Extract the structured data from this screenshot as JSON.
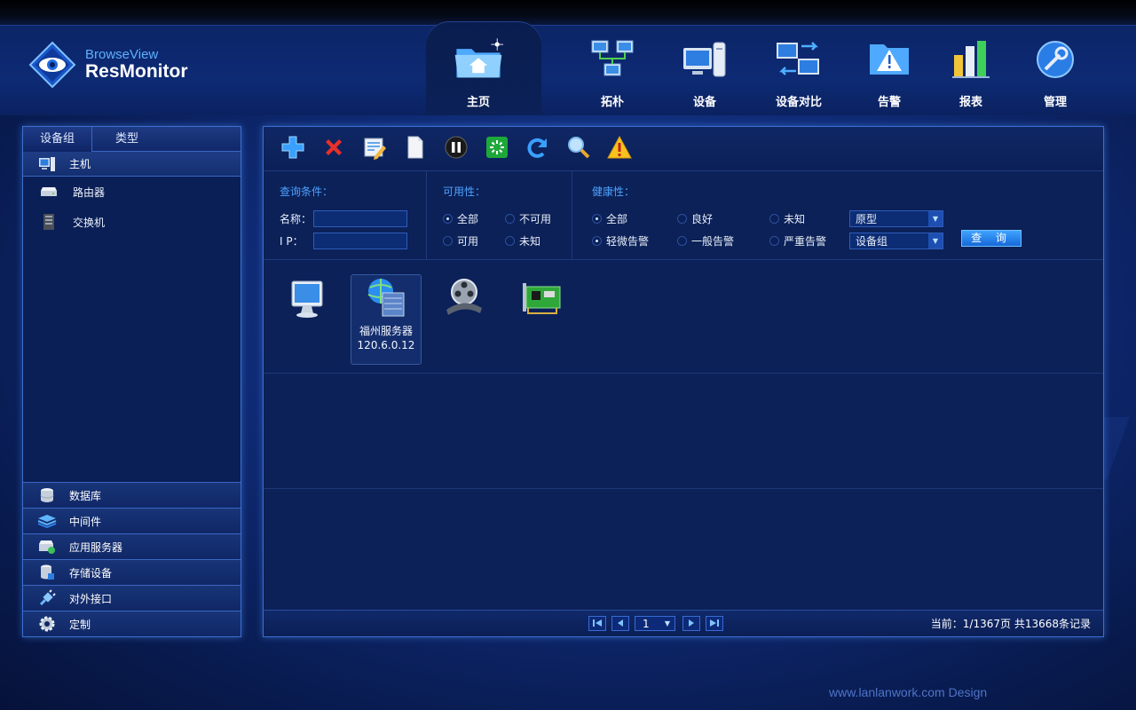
{
  "app": {
    "logo_sub": "BrowseView",
    "logo_main": "ResMonitor"
  },
  "nav": [
    {
      "label": "主页",
      "icon": "home-folder-icon",
      "active": true
    },
    {
      "label": "拓朴",
      "icon": "topology-icon"
    },
    {
      "label": "设备",
      "icon": "device-icon"
    },
    {
      "label": "设备对比",
      "icon": "device-compare-icon"
    },
    {
      "label": "告警",
      "icon": "alarm-icon"
    },
    {
      "label": "报表",
      "icon": "report-icon"
    },
    {
      "label": "管理",
      "icon": "manage-icon"
    }
  ],
  "sidebar": {
    "tabs": [
      "设备组",
      "类型"
    ],
    "active_category": "主机",
    "sub_items": [
      "路由器",
      "交换机"
    ],
    "bottom_categories": [
      "数据库",
      "中间件",
      "应用服务器",
      "存储设备",
      "对外接口",
      "定制"
    ]
  },
  "toolbar": [
    "add-icon",
    "delete-icon",
    "edit-icon",
    "copy-icon",
    "pause-icon",
    "loading-icon",
    "refresh-icon",
    "search-icon",
    "warning-icon"
  ],
  "query": {
    "title": "查询条件：",
    "name_label": "名称：",
    "ip_label": "I P：",
    "name_value": "",
    "ip_value": "",
    "availability_title": "可用性：",
    "availability": [
      {
        "label": "全部",
        "checked": true
      },
      {
        "label": "不可用",
        "checked": false
      },
      {
        "label": "可用",
        "checked": false
      },
      {
        "label": "未知",
        "checked": false
      }
    ],
    "health_title": "健康性：",
    "health": [
      {
        "label": "全部",
        "checked": true
      },
      {
        "label": "良好",
        "checked": false
      },
      {
        "label": "未知",
        "checked": false
      },
      {
        "label": "轻微告警",
        "checked": true
      },
      {
        "label": "一般告警",
        "checked": false
      },
      {
        "label": "严重告警",
        "checked": false
      }
    ],
    "select_prototype": "原型",
    "select_group": "设备组",
    "button": "查 询"
  },
  "devices": [
    {
      "icon": "monitor-icon",
      "name": "",
      "ip": ""
    },
    {
      "icon": "web-server-icon",
      "name": "福州服务器",
      "ip": "120.6.0.12",
      "selected": true
    },
    {
      "icon": "film-reel-icon",
      "name": "",
      "ip": ""
    },
    {
      "icon": "network-card-icon",
      "name": "",
      "ip": ""
    }
  ],
  "pager": {
    "page": "1",
    "info": "当前：1/1367页  共13668条记录"
  },
  "credit": "www.lanlanwork.com Design",
  "colors": {
    "accent": "#3c6fd0",
    "highlight": "#4fa2ff",
    "bg": "#0f2a74"
  }
}
